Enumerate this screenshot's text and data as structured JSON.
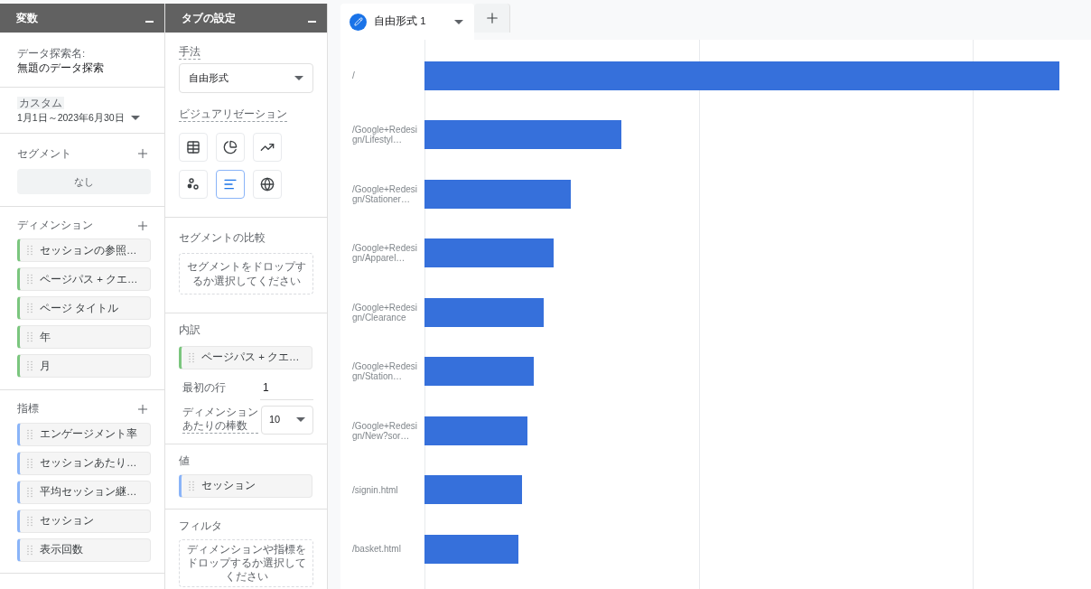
{
  "variables_panel": {
    "title": "変数",
    "exploration_name_label": "データ探索名:",
    "exploration_name": "無題のデータ探索",
    "date_chip": "カスタム",
    "date_range": "1月1日～2023年6月30日",
    "segments": {
      "title": "セグメント",
      "empty": "なし"
    },
    "dimensions": {
      "title": "ディメンション",
      "items": [
        "セッションの参照…",
        "ページパス + クエ…",
        "ページ タイトル",
        "年",
        "月"
      ]
    },
    "metrics": {
      "title": "指標",
      "items": [
        "エンゲージメント率",
        "セッションあたり…",
        "平均セッション継…",
        "セッション",
        "表示回数"
      ]
    }
  },
  "tab_settings_panel": {
    "title": "タブの設定",
    "technique_label": "手法",
    "technique": "自由形式",
    "visualization_label": "ビジュアリゼーション",
    "visualizations": [
      {
        "kind": "table",
        "selected": false
      },
      {
        "kind": "donut",
        "selected": false
      },
      {
        "kind": "line",
        "selected": false
      },
      {
        "kind": "scatter",
        "selected": false
      },
      {
        "kind": "bar",
        "selected": true
      },
      {
        "kind": "map",
        "selected": false
      }
    ],
    "segment_comparison": {
      "title": "セグメントの比較",
      "hint": "セグメントをドロップするか選択してください"
    },
    "breakdown": {
      "title": "内訳",
      "item": "ページパス + クエ…",
      "first_row_label": "最初の行",
      "first_row": "1",
      "bars_label": "ディメンションあたりの棒数",
      "bars_per_dimension": "10"
    },
    "values": {
      "title": "値",
      "item": "セッション"
    },
    "filters": {
      "title": "フィルタ",
      "hint": "ディメンションや指標をドロップするか選択してください"
    }
  },
  "tabs": [
    {
      "label": "自由形式 1",
      "selected": true
    }
  ],
  "chart": {
    "rows": [
      {
        "label": "/"
      },
      {
        "label": "/Google+Redesign/Lifestyl…"
      },
      {
        "label": "/Google+Redesign/Stationer…"
      },
      {
        "label": "/Google+Redesign/Apparel…"
      },
      {
        "label": "/Google+Redesign/Clearance"
      },
      {
        "label": "/Google+Redesign/Station…"
      },
      {
        "label": "/Google+Redesign/New?sor…"
      },
      {
        "label": "/signin.html"
      },
      {
        "label": "/basket.html"
      }
    ]
  }
}
